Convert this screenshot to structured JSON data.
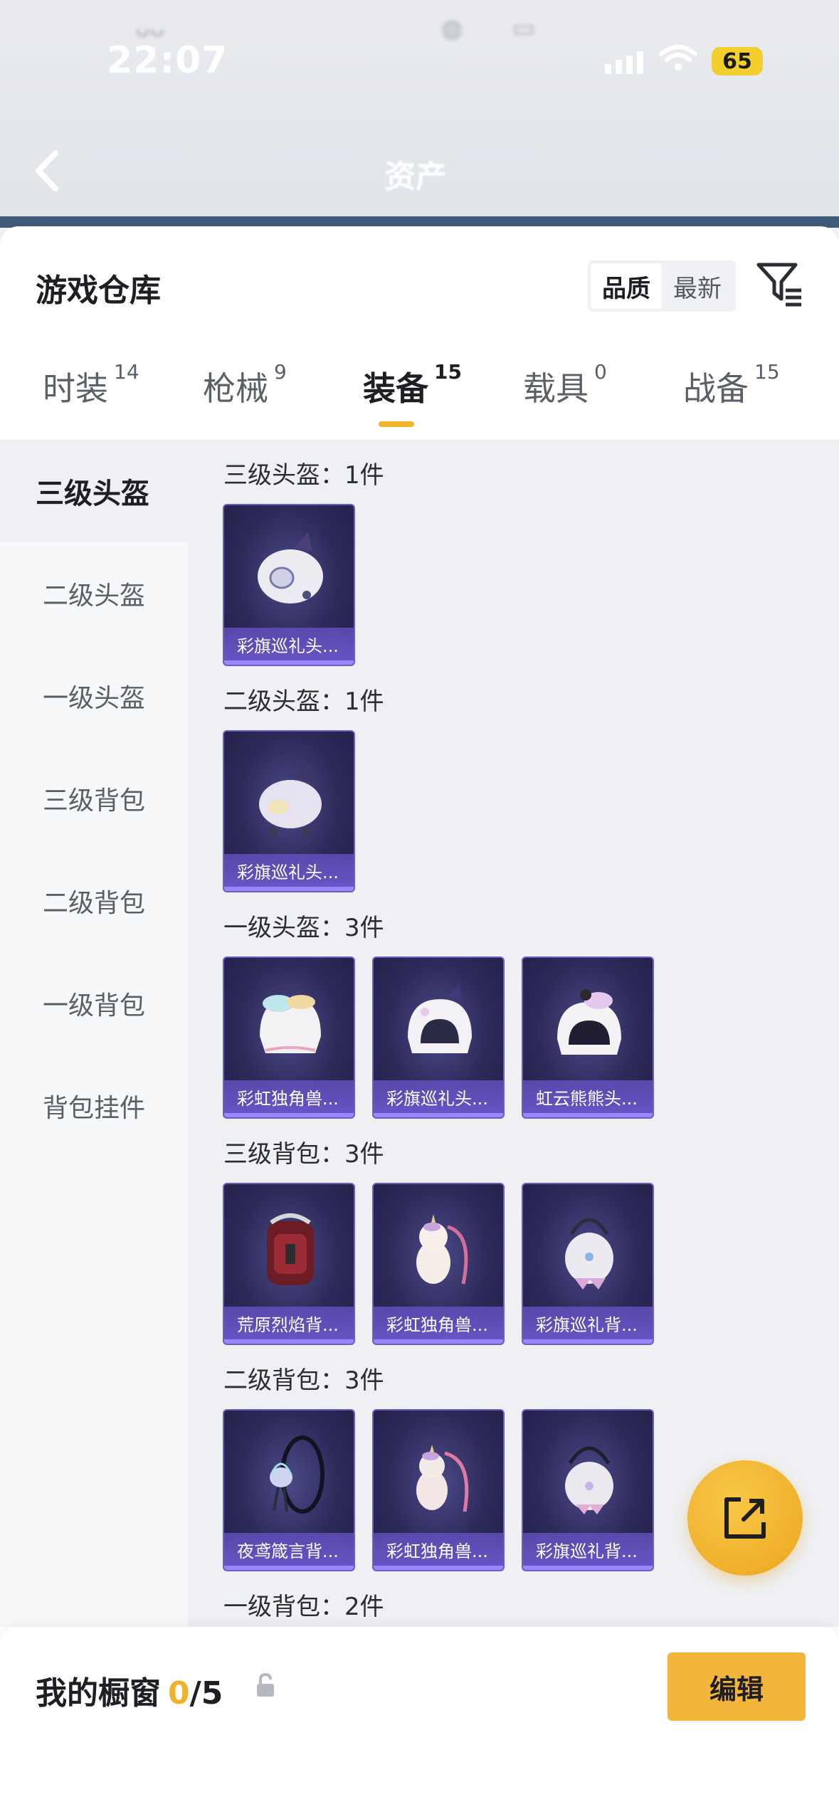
{
  "status": {
    "time": "22:07",
    "battery": "65"
  },
  "nav": {
    "title": "资产"
  },
  "warehouse": {
    "title": "游戏仓库",
    "sort_options": [
      "品质",
      "最新"
    ],
    "tabs": [
      {
        "label": "时装",
        "count": "14"
      },
      {
        "label": "枪械",
        "count": "9"
      },
      {
        "label": "装备",
        "count": "15"
      },
      {
        "label": "载具",
        "count": "0"
      },
      {
        "label": "战备",
        "count": "15"
      }
    ],
    "categories": [
      "三级头盔",
      "二级头盔",
      "一级头盔",
      "三级背包",
      "二级背包",
      "一级背包",
      "背包挂件"
    ],
    "sections": [
      {
        "title": "三级头盔：1件",
        "items": [
          "彩旗巡礼头..."
        ]
      },
      {
        "title": "二级头盔：1件",
        "items": [
          "彩旗巡礼头..."
        ]
      },
      {
        "title": "一级头盔：3件",
        "items": [
          "彩虹独角兽...",
          "彩旗巡礼头...",
          "虹云熊熊头..."
        ]
      },
      {
        "title": "三级背包：3件",
        "items": [
          "荒原烈焰背...",
          "彩虹独角兽...",
          "彩旗巡礼背..."
        ]
      },
      {
        "title": "二级背包：3件",
        "items": [
          "夜鸢箴言背...",
          "彩虹独角兽...",
          "彩旗巡礼背..."
        ]
      },
      {
        "title": "一级背包：2件",
        "items": []
      }
    ]
  },
  "showcase": {
    "label": "我的橱窗",
    "current": "0",
    "total": "/5",
    "edit_label": "编辑"
  }
}
